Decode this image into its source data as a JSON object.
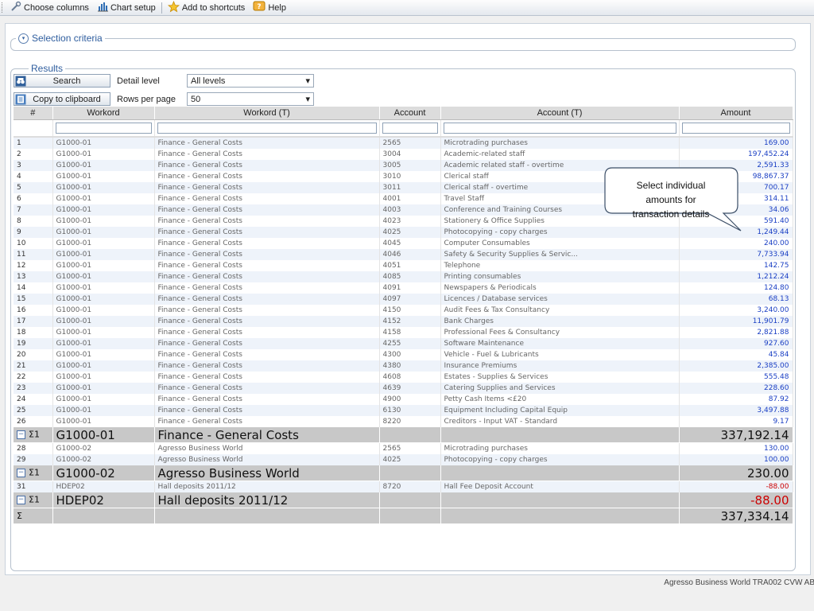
{
  "toolbar": {
    "choose_columns": "Choose columns",
    "chart_setup": "Chart setup",
    "add_shortcuts": "Add to shortcuts",
    "help": "Help"
  },
  "selection": {
    "title": "Selection criteria"
  },
  "results": {
    "title": "Results",
    "search_label": "Search",
    "detail_level_label": "Detail level",
    "detail_level_value": "All levels",
    "copy_label": "Copy to clipboard",
    "rows_per_page_label": "Rows per page",
    "rows_per_page_value": "50"
  },
  "table": {
    "headers": [
      "#",
      "Workord",
      "Workord (T)",
      "Account",
      "Account (T)",
      "Amount"
    ],
    "rows": [
      [
        "1",
        "G1000-01",
        "Finance - General Costs",
        "2565",
        "Microtrading purchases",
        "169.00"
      ],
      [
        "2",
        "G1000-01",
        "Finance - General Costs",
        "3004",
        "Academic-related staff",
        "197,452.24"
      ],
      [
        "3",
        "G1000-01",
        "Finance - General Costs",
        "3005",
        "Academic related staff - overtime",
        "2,591.33"
      ],
      [
        "4",
        "G1000-01",
        "Finance - General Costs",
        "3010",
        "Clerical staff",
        "98,867.37"
      ],
      [
        "5",
        "G1000-01",
        "Finance - General Costs",
        "3011",
        "Clerical staff - overtime",
        "700.17"
      ],
      [
        "6",
        "G1000-01",
        "Finance - General Costs",
        "4001",
        "Travel Staff",
        "314.11"
      ],
      [
        "7",
        "G1000-01",
        "Finance - General Costs",
        "4003",
        "Conference and Training Courses",
        "34.06"
      ],
      [
        "8",
        "G1000-01",
        "Finance - General Costs",
        "4023",
        "Stationery & Office Supplies",
        "591.40"
      ],
      [
        "9",
        "G1000-01",
        "Finance - General Costs",
        "4025",
        "Photocopying - copy charges",
        "1,249.44"
      ],
      [
        "10",
        "G1000-01",
        "Finance - General Costs",
        "4045",
        "Computer Consumables",
        "240.00"
      ],
      [
        "11",
        "G1000-01",
        "Finance - General Costs",
        "4046",
        "Safety & Security Supplies & Servic...",
        "7,733.94"
      ],
      [
        "12",
        "G1000-01",
        "Finance - General Costs",
        "4051",
        "Telephone",
        "142.75"
      ],
      [
        "13",
        "G1000-01",
        "Finance - General Costs",
        "4085",
        "Printing consumables",
        "1,212.24"
      ],
      [
        "14",
        "G1000-01",
        "Finance - General Costs",
        "4091",
        "Newspapers & Periodicals",
        "124.80"
      ],
      [
        "15",
        "G1000-01",
        "Finance - General Costs",
        "4097",
        "Licences / Database services",
        "68.13"
      ],
      [
        "16",
        "G1000-01",
        "Finance - General Costs",
        "4150",
        "Audit Fees & Tax Consultancy",
        "3,240.00"
      ],
      [
        "17",
        "G1000-01",
        "Finance - General Costs",
        "4152",
        "Bank Charges",
        "11,901.79"
      ],
      [
        "18",
        "G1000-01",
        "Finance - General Costs",
        "4158",
        "Professional Fees & Consultancy",
        "2,821.88"
      ],
      [
        "19",
        "G1000-01",
        "Finance - General Costs",
        "4255",
        "Software Maintenance",
        "927.60"
      ],
      [
        "20",
        "G1000-01",
        "Finance - General Costs",
        "4300",
        "Vehicle - Fuel & Lubricants",
        "45.84"
      ],
      [
        "21",
        "G1000-01",
        "Finance - General Costs",
        "4380",
        "Insurance Premiums",
        "2,385.00"
      ],
      [
        "22",
        "G1000-01",
        "Finance - General Costs",
        "4608",
        "Estates - Supplies & Services",
        "555.48"
      ],
      [
        "23",
        "G1000-01",
        "Finance - General Costs",
        "4639",
        "Catering Supplies and Services",
        "228.60"
      ],
      [
        "24",
        "G1000-01",
        "Finance - General Costs",
        "4900",
        "Petty Cash Items <£20",
        "87.92"
      ],
      [
        "25",
        "G1000-01",
        "Finance - General Costs",
        "6130",
        "Equipment Including Capital Equip",
        "3,497.88"
      ],
      [
        "26",
        "G1000-01",
        "Finance - General Costs",
        "8220",
        "Creditors - Input VAT - Standard",
        "9.17"
      ]
    ],
    "subtotal1": {
      "sigma": "Σ1",
      "workord": "G1000-01",
      "workord_t": "Finance - General Costs",
      "amount": "337,192.14"
    },
    "rows2": [
      [
        "28",
        "G1000-02",
        "Agresso Business World",
        "2565",
        "Microtrading purchases",
        "130.00"
      ],
      [
        "29",
        "G1000-02",
        "Agresso Business World",
        "4025",
        "Photocopying - copy charges",
        "100.00"
      ]
    ],
    "subtotal2": {
      "sigma": "Σ1",
      "workord": "G1000-02",
      "workord_t": "Agresso Business World",
      "amount": "230.00"
    },
    "rows3": [
      [
        "31",
        "HDEP02",
        "Hall deposits 2011/12",
        "8720",
        "Hall Fee Deposit Account",
        "-88.00"
      ]
    ],
    "subtotal3": {
      "sigma": "Σ1",
      "workord": "HDEP02",
      "workord_t": "Hall deposits 2011/12",
      "amount": "-88.00"
    },
    "total": {
      "sigma": "Σ",
      "amount": "337,334.14"
    }
  },
  "callout": {
    "line1": "Select individual",
    "line2": "amounts for",
    "line3": "transaction details"
  },
  "footer": {
    "text": "Agresso Business World  TRA002  CVW  AB"
  },
  "colors": {
    "amount_link": "#1a3fc4",
    "negative": "#cc0000",
    "subtotal_bg": "#c8c8c8",
    "legend_blue": "#2e5d9e"
  },
  "icons": [
    "wrench-icon",
    "chart-icon",
    "star-icon",
    "help-icon",
    "binoculars-icon",
    "clipboard-icon",
    "chevron-down-icon",
    "collapse-minus-icon"
  ]
}
